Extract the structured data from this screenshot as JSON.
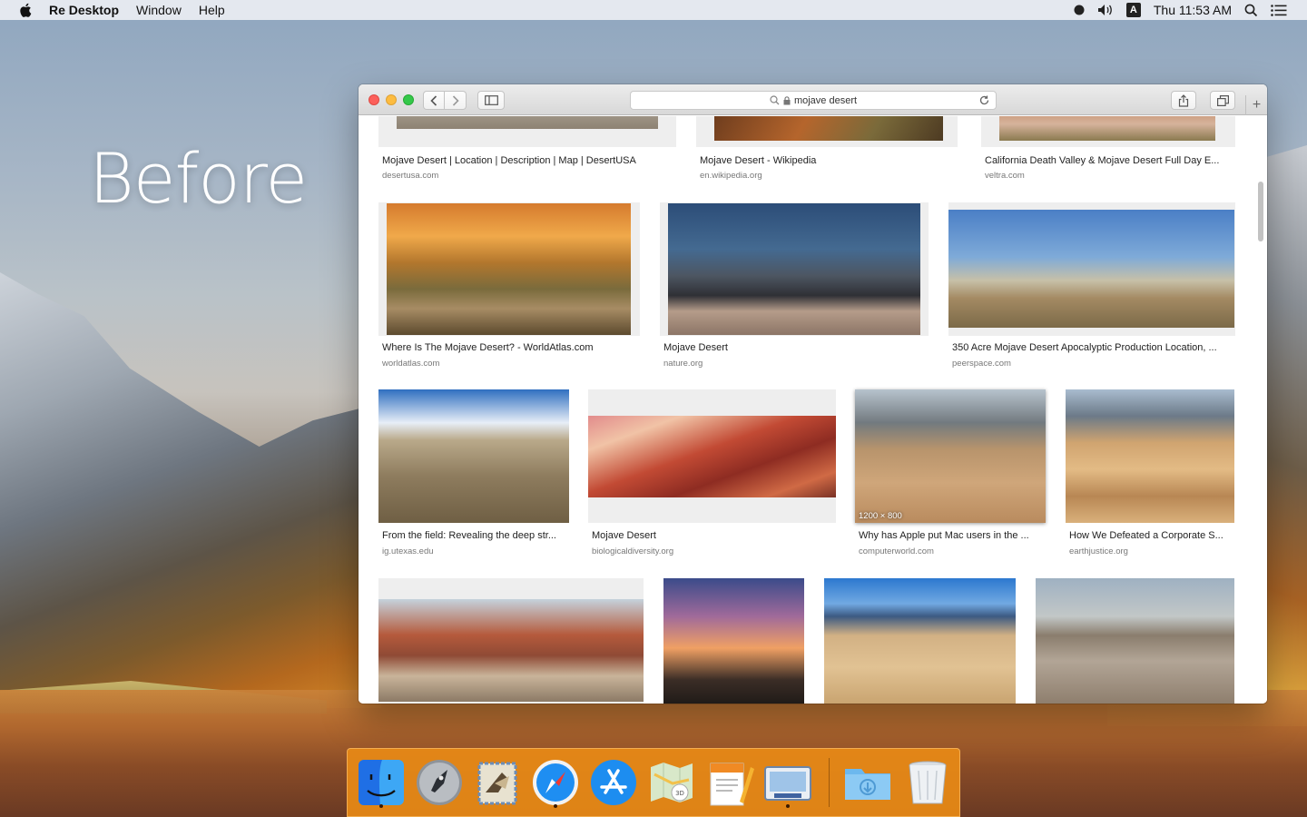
{
  "desktop": {
    "overlay_label": "Before"
  },
  "menubar": {
    "app_name": "Re Desktop",
    "menus": [
      "Window",
      "Help"
    ],
    "clock": "Thu 11:53 AM",
    "input_source": "A"
  },
  "browser": {
    "address": "mojave desert",
    "results_rows": [
      [
        {
          "caption": "Mojave Desert | Location | Description | Map | DesertUSA",
          "source": "desertusa.com"
        },
        {
          "caption": "Mojave Desert - Wikipedia",
          "source": "en.wikipedia.org"
        },
        {
          "caption": "California Death Valley & Mojave Desert Full Day E...",
          "source": "veltra.com"
        }
      ],
      [
        {
          "caption": "Where Is The Mojave Desert? - WorldAtlas.com",
          "source": "worldatlas.com"
        },
        {
          "caption": "Mojave Desert",
          "source": "nature.org"
        },
        {
          "caption": "350 Acre Mojave Desert Apocalyptic Production Location, ...",
          "source": "peerspace.com"
        }
      ],
      [
        {
          "caption": "From the field: Revealing the deep str...",
          "source": "ig.utexas.edu"
        },
        {
          "caption": "Mojave Desert",
          "source": "biologicaldiversity.org"
        },
        {
          "caption": "Why has Apple put Mac users in the ...",
          "source": "computerworld.com",
          "dimensions": "1200 × 800"
        },
        {
          "caption": "How We Defeated a Corporate S...",
          "source": "earthjustice.org"
        }
      ]
    ]
  },
  "dock": {
    "apps": [
      "finder-icon",
      "launchpad-icon",
      "mail-icon",
      "safari-icon",
      "app-store-icon",
      "maps-icon",
      "pages-icon",
      "re-desktop-icon",
      "downloads-folder-icon",
      "trash-icon"
    ]
  }
}
